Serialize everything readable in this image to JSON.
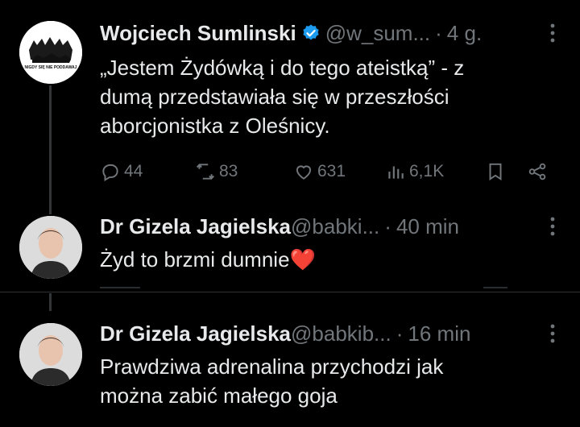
{
  "tweets": [
    {
      "name": "Wojciech Sumlinski",
      "handle": "@w_sum...",
      "dot": "·",
      "time": "4 g.",
      "text": "„Jestem Żydówką i do tego ateistką” - z dumą przedstawiała się w przeszłości aborcjonistka z Oleśnicy.",
      "avatar_caption": "NIGDY SIĘ NIE PODDAWAJ",
      "verified": true,
      "actions": {
        "replies": "44",
        "reposts": "83",
        "likes": "631",
        "views": "6,1K"
      }
    },
    {
      "name": "Dr Gizela Jagielska",
      "handle": "@babki...",
      "dot": "·",
      "time": "40 min",
      "text": "Żyd to brzmi dumnie",
      "emoji": "❤️"
    },
    {
      "name": "Dr Gizela Jagielska",
      "handle": "@babkib...",
      "dot": "·",
      "time": "16 min",
      "text": "Prawdziwa adrenalina przychodzi jak można zabić małego goja"
    }
  ],
  "colors": {
    "background": "#000000",
    "text": "#e7e9ea",
    "muted": "#71767b",
    "verified": "#1d9bf0",
    "heart": "#f91880"
  }
}
